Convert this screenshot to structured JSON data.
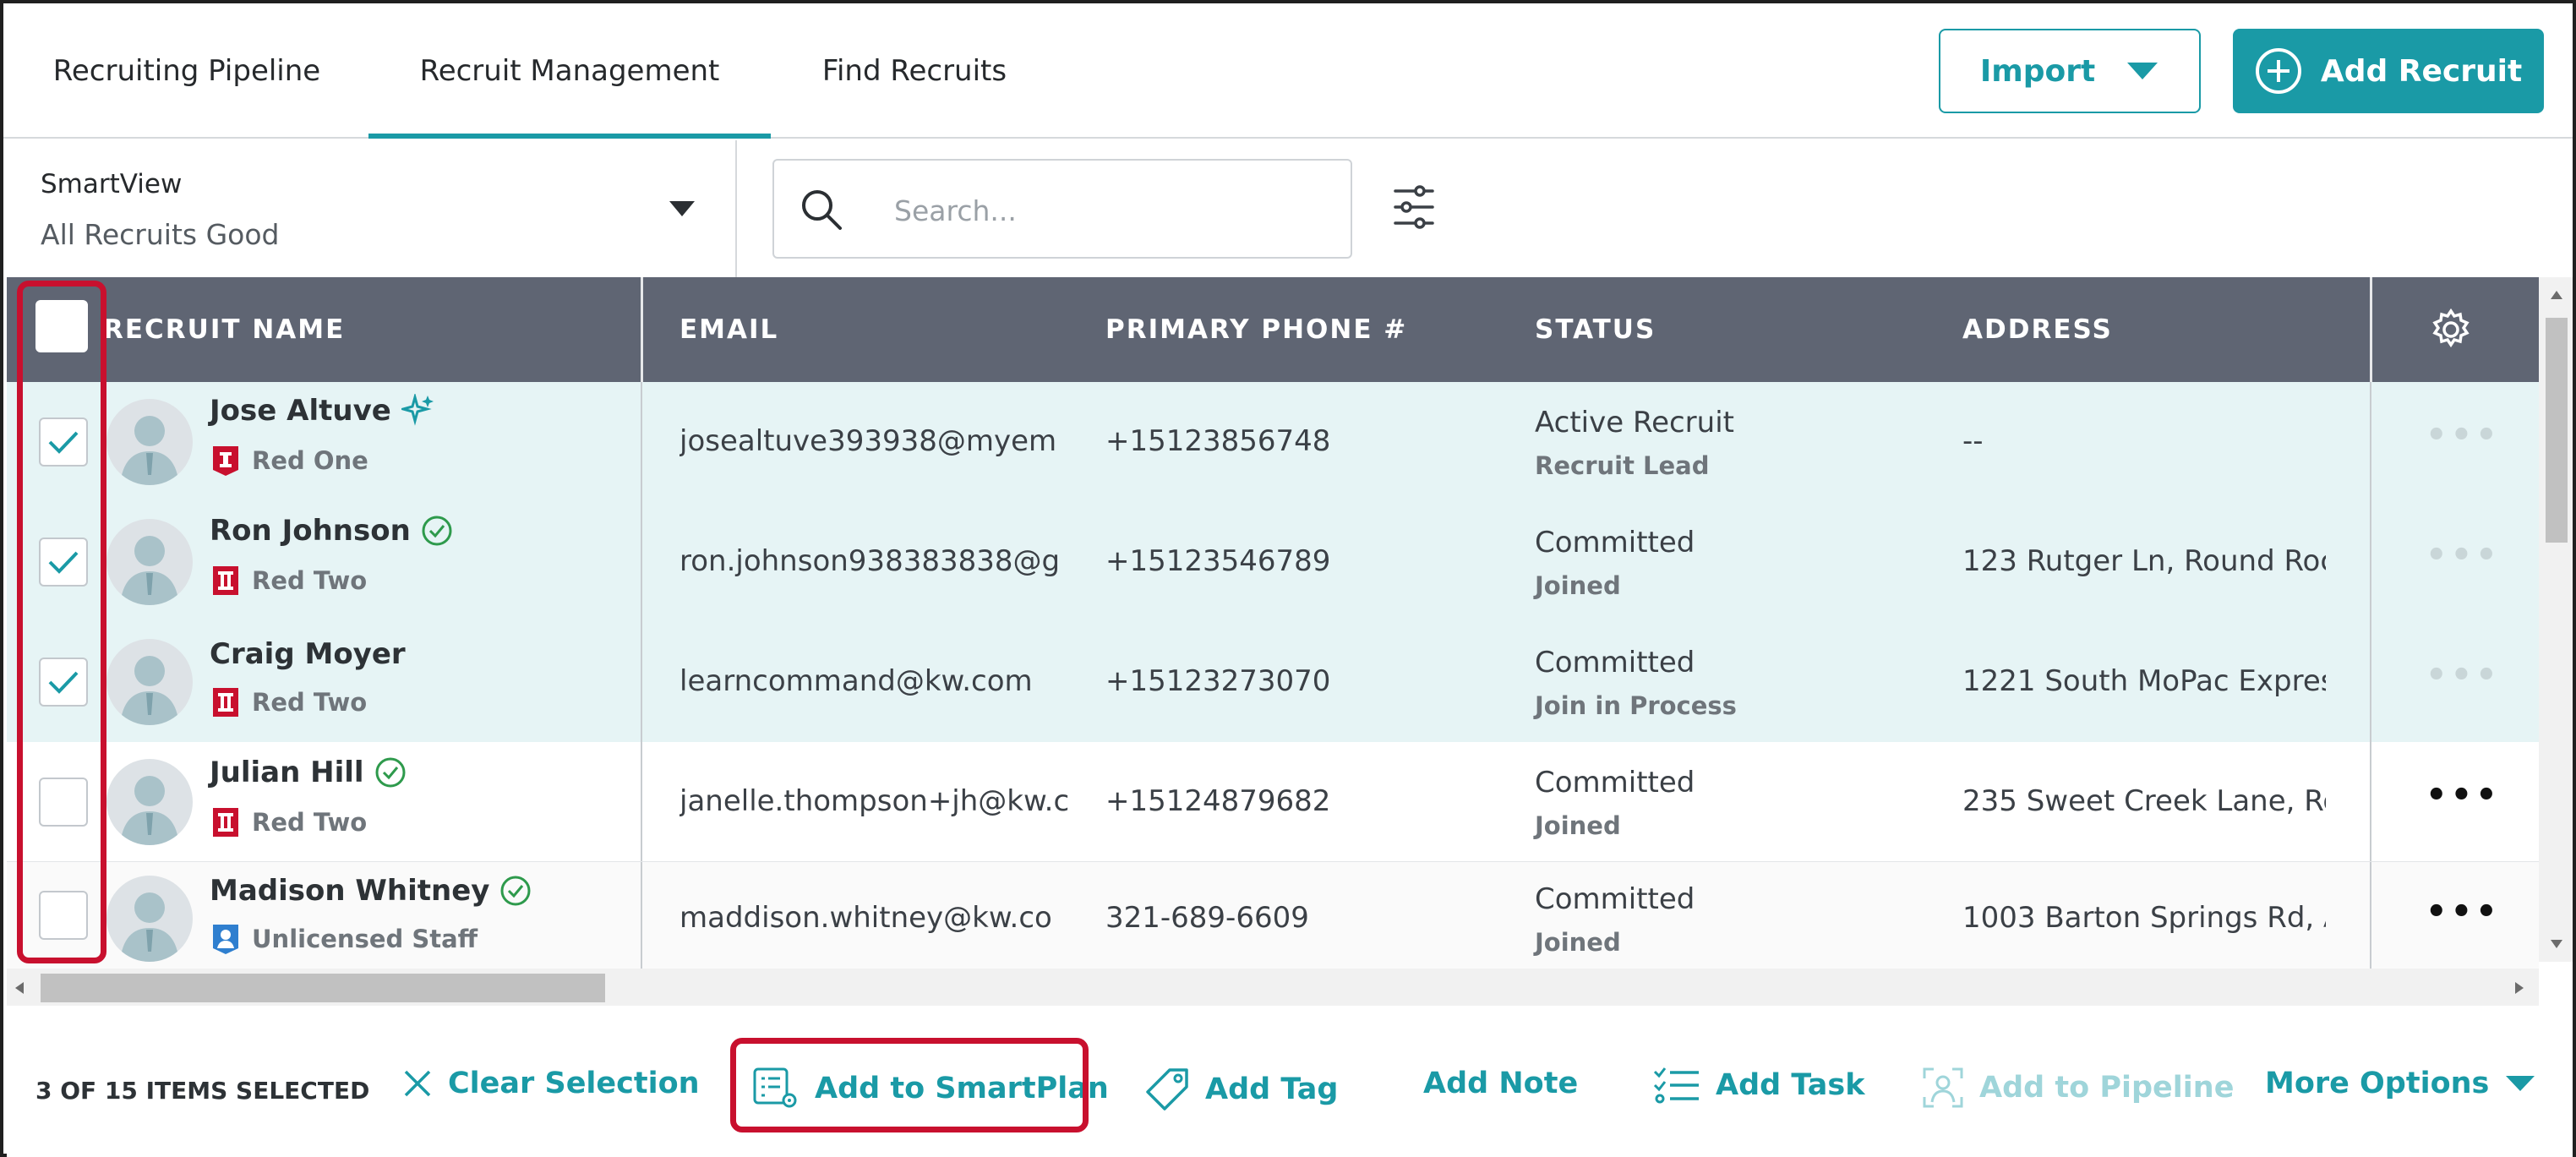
{
  "tabs": [
    "Recruiting Pipeline",
    "Recruit Management",
    "Find Recruits"
  ],
  "header": {
    "import_label": "Import",
    "add_recruit_label": "Add Recruit"
  },
  "smartview": {
    "label": "SmartView",
    "value": "All Recruits Good"
  },
  "search": {
    "placeholder": "Search..."
  },
  "columns": [
    "RECRUIT NAME",
    "EMAIL",
    "PRIMARY PHONE #",
    "STATUS",
    "ADDRESS"
  ],
  "rows": [
    {
      "name": "Jose Altuve",
      "name_icon": "sparkle-icon",
      "badge": "Red One",
      "badge_icon": "red-one-badge-icon",
      "email": "josealtuve393938@myem",
      "phone": "+15123856748",
      "status": "Active Recruit",
      "substatus": "Recruit Lead",
      "address": "--",
      "selected": true
    },
    {
      "name": "Ron Johnson",
      "name_icon": "verified-check-icon",
      "badge": "Red Two",
      "badge_icon": "red-two-badge-icon",
      "email": "ron.johnson938383838@g",
      "phone": "+15123546789",
      "status": "Committed",
      "substatus": "Joined",
      "address": "123 Rutger Ln, Round Roc",
      "selected": true
    },
    {
      "name": "Craig Moyer",
      "name_icon": "",
      "badge": "Red Two",
      "badge_icon": "red-two-badge-icon",
      "email": "learncommand@kw.com",
      "phone": "+15123273070",
      "status": "Committed",
      "substatus": "Join in Process",
      "address": "1221 South MoPac Expres",
      "selected": true
    },
    {
      "name": "Julian Hill",
      "name_icon": "verified-check-icon",
      "badge": "Red Two",
      "badge_icon": "red-two-badge-icon",
      "email": "janelle.thompson+jh@kw.c",
      "phone": "+15124879682",
      "status": "Committed",
      "substatus": "Joined",
      "address": "235 Sweet Creek Lane, Ro",
      "selected": false
    },
    {
      "name": "Madison Whitney",
      "name_icon": "verified-check-icon",
      "badge": "Unlicensed Staff",
      "badge_icon": "unlicensed-staff-badge-icon",
      "email": "maddison.whitney@kw.co",
      "phone": "321-689-6609",
      "status": "Committed",
      "substatus": "Joined",
      "address": "1003 Barton Springs Rd, A",
      "selected": false
    }
  ],
  "row_menu_glyph": "•••",
  "actionbar": {
    "selection_count": "3 OF 15 ITEMS SELECTED",
    "clear_selection": "Clear Selection",
    "add_to_smartplan": "Add to SmartPlan",
    "add_tag": "Add Tag",
    "add_note": "Add Note",
    "add_task": "Add Task",
    "add_to_pipeline": "Add to Pipeline",
    "more_options": "More Options"
  },
  "colors": {
    "accent": "#1a9aa6",
    "header_bg": "#5f6573",
    "selected_row_bg": "#e6f4f5",
    "highlight": "#c8102e",
    "disabled_action": "#9fd5da"
  }
}
